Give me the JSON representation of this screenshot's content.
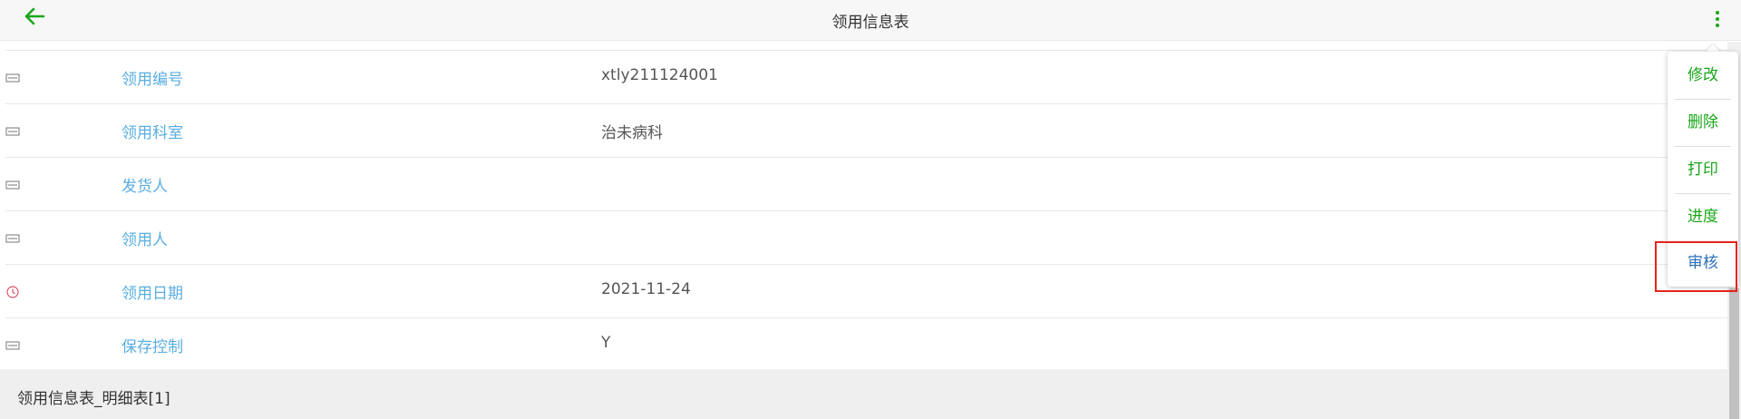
{
  "header": {
    "title": "领用信息表",
    "back_icon": "arrow-left-icon",
    "more_icon": "more-vertical-icon",
    "accent_color": "#1aa61a"
  },
  "form": {
    "rows": [
      {
        "icon": "text-field-icon",
        "label": "领用编号",
        "value": "xtly211124001"
      },
      {
        "icon": "text-field-icon",
        "label": "领用科室",
        "value": "治未病科"
      },
      {
        "icon": "text-field-icon",
        "label": "发货人",
        "value": ""
      },
      {
        "icon": "text-field-icon",
        "label": "领用人",
        "value": ""
      },
      {
        "icon": "clock-icon",
        "label": "领用日期",
        "value": "2021-11-24"
      },
      {
        "icon": "text-field-icon",
        "label": "保存控制",
        "value": "Y"
      }
    ],
    "label_color": "#5aaee0"
  },
  "section": {
    "title": "领用信息表_明细表[1]"
  },
  "menu": {
    "items": [
      {
        "label": "修改"
      },
      {
        "label": "删除"
      },
      {
        "label": "打印"
      },
      {
        "label": "进度"
      },
      {
        "label": "审核"
      }
    ],
    "highlighted_item": "审核",
    "highlight_color": "#e8231c"
  }
}
